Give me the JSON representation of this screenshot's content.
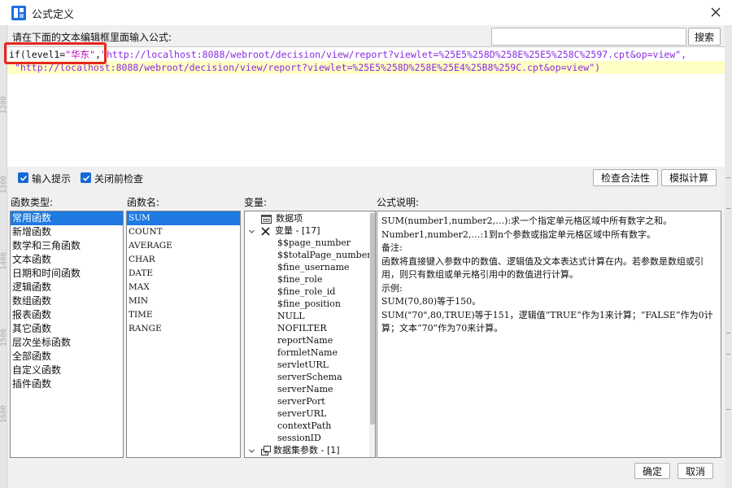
{
  "window": {
    "title": "公式定义"
  },
  "prompt_label": "请在下面的文本编辑框里面输入公式:",
  "search": {
    "value": "",
    "placeholder": "",
    "button_label": "搜索"
  },
  "editor": {
    "line1_prefix": "if(level1=",
    "line1_zh": "\"华东\"",
    "line1_comma": ",",
    "line1_url": "\"http://localhost:8088/webroot/decision/view/report?viewlet=%25E5%258D%258E%25E5%258C%2597.cpt&op=view\",",
    "line2_url": "\"http://localhost:8088/webroot/decision/view/report?viewlet=%25E5%258D%258E%25E4%25B8%259C.cpt&op=view\")"
  },
  "options": {
    "input_hint": {
      "label": "输入提示",
      "checked": true
    },
    "check_before_close": {
      "label": "关闭前检查",
      "checked": true
    },
    "check_validity_button": "检查合法性",
    "simulate_button": "模拟计算"
  },
  "panels": {
    "function_type_header": "函数类型:",
    "function_name_header": "函数名:",
    "variable_header": "变量:",
    "description_header": "公式说明:"
  },
  "function_types": [
    "常用函数",
    "新增函数",
    "数学和三角函数",
    "文本函数",
    "日期和时间函数",
    "逻辑函数",
    "数组函数",
    "报表函数",
    "其它函数",
    "层次坐标函数",
    "全部函数",
    "自定义函数",
    "插件函数"
  ],
  "selected_function_type": 0,
  "function_names": [
    "SUM",
    "COUNT",
    "AVERAGE",
    "CHAR",
    "DATE",
    "MAX",
    "MIN",
    "TIME",
    "RANGE"
  ],
  "selected_function_name": 0,
  "variables": {
    "data_item": "数据项",
    "var_group": "变量 - [17]",
    "items": [
      "$$page_number",
      "$$totalPage_number",
      "$fine_username",
      "$fine_role",
      "$fine_role_id",
      "$fine_position",
      "NULL",
      "NOFILTER",
      "reportName",
      "formletName",
      "servletURL",
      "serverSchema",
      "serverName",
      "serverPort",
      "serverURL",
      "contextPath",
      "sessionID"
    ],
    "dataset_params": "数据集参数 - [1]"
  },
  "description_lines": [
    "SUM(number1,number2,…):求一个指定单元格区域中所有数字之和。",
    "Number1,number2,…:1到n个参数或指定单元格区域中所有数字。",
    "备注:",
    "函数将直接键入参数中的数值、逻辑值及文本表达式计算在内。若参数是数组或引用，则只有数组或单元格引用中的数值进行计算。",
    "示例:",
    "SUM(70,80)等于150。",
    "SUM(\"70\",80,TRUE)等于151，逻辑值“TRUE”作为1来计算；“FALSE”作为0计算；文本“70”作为70来计算。"
  ],
  "footer": {
    "ok": "确定",
    "cancel": "取消"
  },
  "background_ruler": {
    "numbers": [
      "1200",
      "1300",
      "1400",
      "1500",
      "1600"
    ]
  },
  "colors": {
    "selection": "#1e7ae0",
    "highlight_box": "#e8261f",
    "line_highlight": "#ffffc4",
    "string": "#8a2be2",
    "checkbox": "#1668d6"
  }
}
